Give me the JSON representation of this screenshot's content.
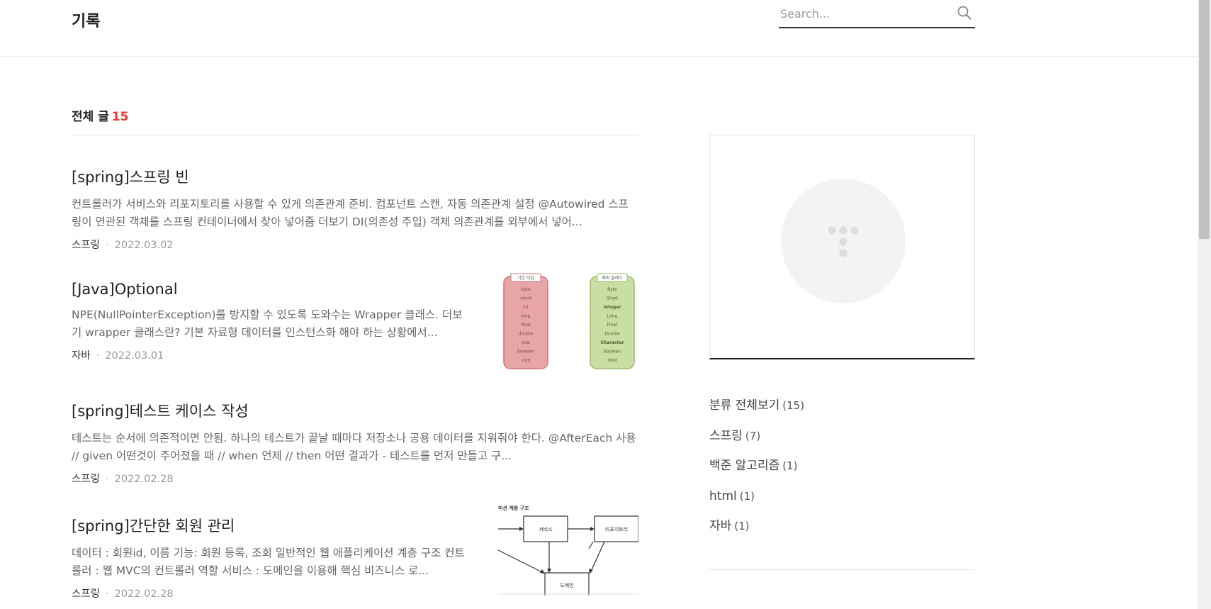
{
  "header": {
    "blog_title": "기록",
    "search_placeholder": "Search..."
  },
  "list": {
    "heading": "전체 글",
    "count": "15"
  },
  "posts": [
    {
      "title": "[spring]스프링 빈",
      "summary": "컨트롤러가 서비스와 리포지토리를 사용할 수 있게 의존관계 준비. 컴포넌트 스캔, 자동 의존관계 설정 @Autowired 스프링이 연관된 객체를 스프링 컨테이너에서 찾아 넣어줌 더보기 DI(의존성 주입) 객체 의존관계를 외부에서 넣어...",
      "category": "스프링",
      "date": "2022.03.02"
    },
    {
      "title": "[Java]Optional",
      "summary": "NPE(NullPointerException)를 방지할 수 있도록 도와수는 Wrapper 클래스. 더보기 wrapper 클래스란? 기본 자료형 데이터를 인스턴스화 해야 하는 상황에서...",
      "category": "자바",
      "date": "2022.03.01",
      "thumb": {
        "left_title": "기본 타입",
        "right_title": "래퍼 클래스",
        "left_items": [
          "byte",
          "short",
          "int",
          "long",
          "float",
          "double",
          "char",
          "boolean",
          "void"
        ],
        "right_items": [
          "Byte",
          "Short",
          "Integer",
          "Long",
          "Float",
          "Double",
          "Character",
          "Boolean",
          "Void"
        ]
      }
    },
    {
      "title": "[spring]테스트 케이스 작성",
      "summary": "테스트는 순서에 의존적이면 안됨. 하나의 테스트가 끝날 때마다 저장소나 공용 데이터를 지워줘야 한다. @AfterEach 사용 // given 어떤것이 주어졌을 때 // when 언제 // then 어떤 결과가 - 테스트를 먼저 만들고 구...",
      "category": "스프링",
      "date": "2022.02.28"
    },
    {
      "title": "[spring]간단한 회원 관리",
      "summary": "데이터 : 회원id, 이름 기능: 회원 등록, 조회 일반적인 웹 애플리케이션 계층 구조 컨트롤러 : 웹 MVC의 컨트롤러 역할 서비스 : 도메인을 이용해 핵심 비즈니스 로...",
      "category": "스프링",
      "date": "2022.02.28",
      "thumb": {
        "diagram_title": "미션 계층 구조",
        "box_service": "서비스",
        "box_repository": "리포지토리",
        "box_domain": "도메인"
      }
    }
  ],
  "sidebar": {
    "categories": [
      {
        "label": "분류 전체보기",
        "count": "(15)"
      },
      {
        "label": "스프링",
        "count": "(7)"
      },
      {
        "label": "백준 알고리즘",
        "count": "(1)"
      },
      {
        "label": "html",
        "count": "(1)"
      },
      {
        "label": "자바",
        "count": "(1)"
      }
    ]
  }
}
